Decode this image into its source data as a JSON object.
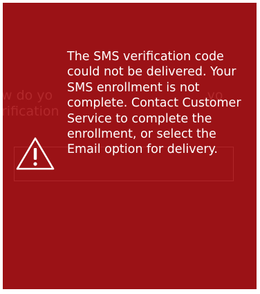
{
  "alert": {
    "icon": "warning-icon",
    "message": "The SMS verification code could not be delivered. Your SMS enrollment is not complete. Contact Customer Service to complete the enrollment, or select the Email option for delivery.",
    "background_color": "#9b1216",
    "text_color": "#ffffff"
  }
}
